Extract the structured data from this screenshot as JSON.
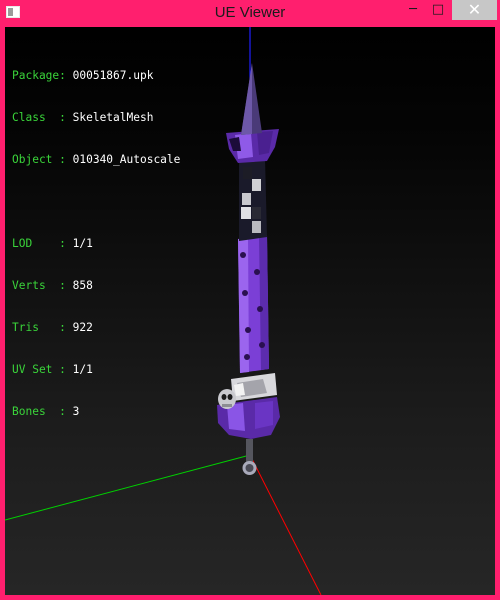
{
  "window": {
    "title": "UE Viewer",
    "accent_color": "#ff1f6e"
  },
  "titlebar_buttons": {
    "minimize": "─",
    "maximize": "□",
    "close": "✕"
  },
  "info": [
    {
      "label": "Package: ",
      "value": "00051867.upk"
    },
    {
      "label": "Class  : ",
      "value": "SkeletalMesh"
    },
    {
      "label": "Object : ",
      "value": "010340_Autoscale"
    }
  ],
  "stats": [
    {
      "label": "LOD    : ",
      "value": "1/1"
    },
    {
      "label": "Verts  : ",
      "value": "858"
    },
    {
      "label": "Tris   : ",
      "value": "922"
    },
    {
      "label": "UV Set : ",
      "value": "1/1"
    },
    {
      "label": "Bones  : ",
      "value": "3"
    }
  ],
  "colors": {
    "label_green": "#3ad43a",
    "value_white": "#ffffff",
    "axis_x": "#ff0000",
    "axis_y": "#00d000",
    "axis_z": "#2020ff",
    "mesh_purple": "#7b3fd6"
  }
}
